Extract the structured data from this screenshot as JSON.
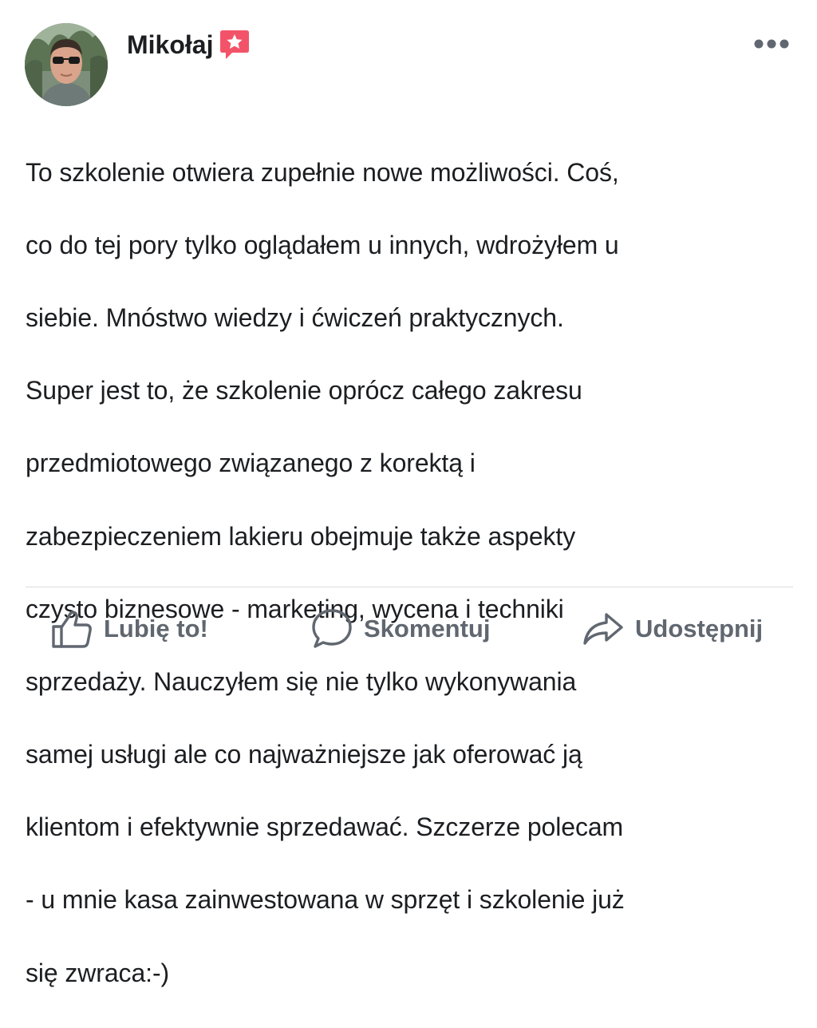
{
  "post": {
    "author": {
      "name": "Mikołaj",
      "badge_icon": "star-badge-icon",
      "badge_color": "#f35369"
    },
    "more_icon": "more-horizontal-icon",
    "lines": [
      "To szkolenie otwiera zupełnie nowe możliwości. Coś,",
      "co do tej pory tylko oglądałem u innych, wdrożyłem u",
      "siebie. Mnóstwo wiedzy i ćwiczeń praktycznych.",
      "Super jest to, że szkolenie oprócz całego zakresu",
      "przedmiotowego związanego z korektą i",
      "zabezpieczeniem lakieru obejmuje także aspekty",
      "czysto biznesowe - marketing, wycena i techniki",
      "sprzedaży. Nauczyłem się nie tylko wykonywania",
      "samej usługi ale co najważniejsze jak oferować ją",
      "klientom i efektywnie sprzedawać. Szczerze polecam",
      "- u mnie kasa zainwestowana w sprzęt i szkolenie już",
      "się zwraca:-)"
    ]
  },
  "actions": {
    "like": {
      "label": "Lubię to!",
      "icon": "thumbs-up-icon"
    },
    "comment": {
      "label": "Skomentuj",
      "icon": "comment-bubble-icon"
    },
    "share": {
      "label": "Udostępnij",
      "icon": "share-arrow-icon"
    }
  },
  "colors": {
    "text": "#1c1e21",
    "action_text": "#606770",
    "divider": "#dadde1",
    "badge": "#f35369"
  }
}
